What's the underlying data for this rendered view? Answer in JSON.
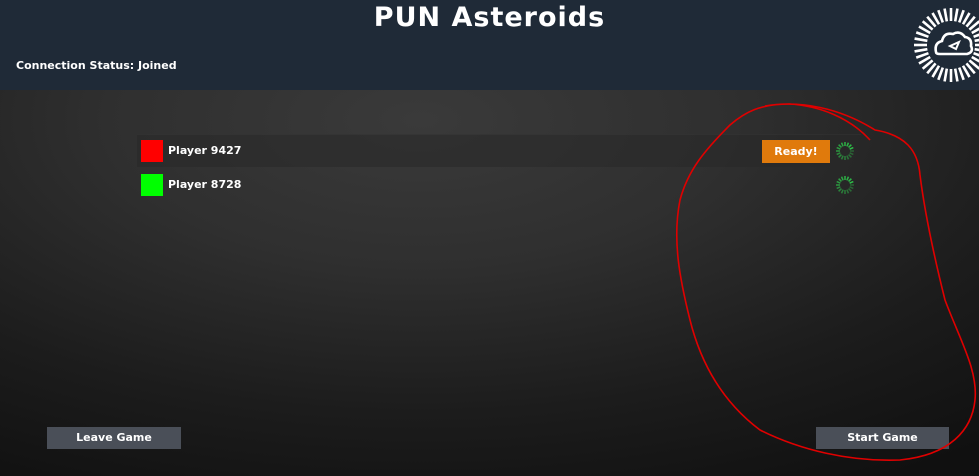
{
  "header": {
    "title": "PUN Asteroids",
    "connection_status": "Connection Status: Joined"
  },
  "players": [
    {
      "name": "Player 9427",
      "color": "#ff0000",
      "ready_label": "Ready!",
      "status_icon": "spinner-icon"
    },
    {
      "name": "Player 8728",
      "color": "#00ff00",
      "status_icon": "spinner-icon"
    }
  ],
  "buttons": {
    "leave_label": "Leave Game",
    "start_label": "Start Game"
  },
  "colors": {
    "header_bg": "#1f2a37",
    "ready_button": "#e07a0c",
    "spinner": "#2ec44a",
    "annotation": "#e00000"
  }
}
